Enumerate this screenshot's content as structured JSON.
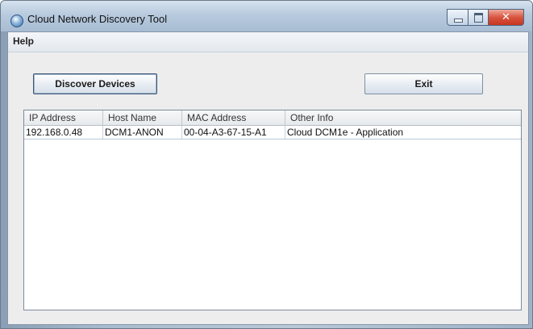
{
  "window": {
    "title": "Cloud Network Discovery Tool"
  },
  "menu": {
    "help": "Help"
  },
  "buttons": {
    "discover": "Discover Devices",
    "exit": "Exit"
  },
  "table": {
    "columns": [
      "IP Address",
      "Host Name",
      "MAC Address",
      "Other Info"
    ],
    "rows": [
      [
        "192.168.0.48",
        "DCM1-ANON",
        "00-04-A3-67-15-A1",
        "Cloud DCM1e - Application"
      ]
    ]
  },
  "icons": {
    "app": "cloud-app-icon",
    "minimize": "minimize-icon",
    "maximize": "maximize-icon",
    "close": "close-icon"
  },
  "colors": {
    "title_gradient": "#b8cade",
    "close_button": "#c7341f",
    "frame_bg": "#ededed"
  }
}
